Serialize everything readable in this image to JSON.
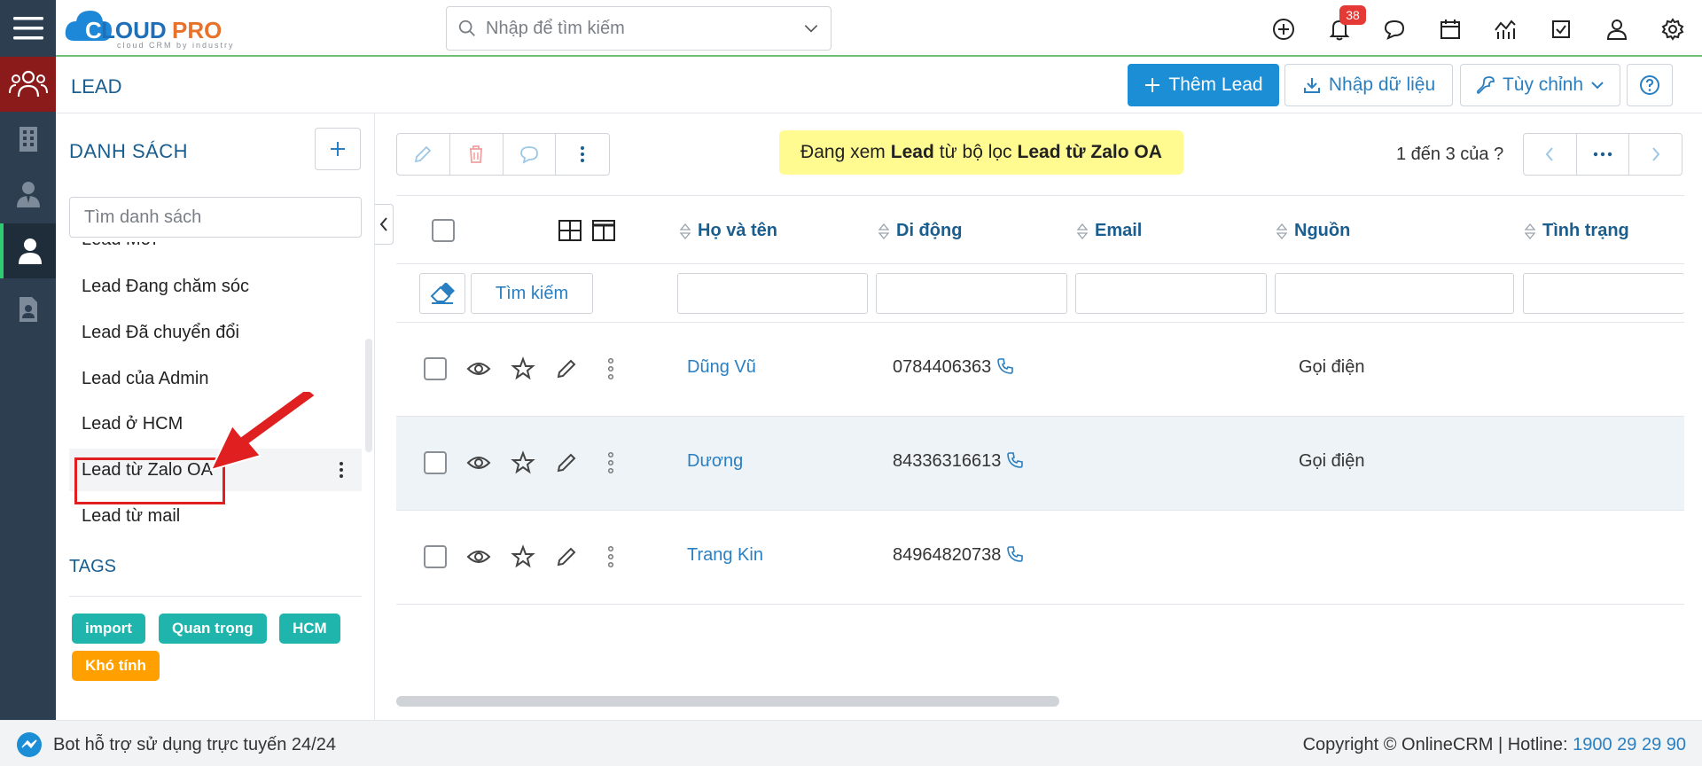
{
  "brand": {
    "name": "CLOUDPRO",
    "tagline": "cloud CRM by industry"
  },
  "topbar": {
    "search_placeholder": "Nhập để tìm kiếm",
    "notification_count": "38"
  },
  "header": {
    "title": "LEAD",
    "add_label": "Thêm Lead",
    "import_label": "Nhập dữ liệu",
    "customize_label": "Tùy chỉnh"
  },
  "lists": {
    "title": "DANH SÁCH",
    "search_placeholder": "Tìm danh sách",
    "items": [
      {
        "label": "Lead Mới"
      },
      {
        "label": "Lead Đang chăm sóc"
      },
      {
        "label": "Lead Đã chuyển đổi"
      },
      {
        "label": "Lead của Admin"
      },
      {
        "label": "Lead ở HCM"
      },
      {
        "label": "Lead từ Zalo OA"
      },
      {
        "label": "Lead từ mail"
      }
    ],
    "active_index": 5
  },
  "tags": {
    "title": "TAGS",
    "items": [
      {
        "label": "import",
        "color": "#1fb5ac"
      },
      {
        "label": "Quan trọng",
        "color": "#1fb5ac"
      },
      {
        "label": "HCM",
        "color": "#1fb5ac"
      },
      {
        "label": "Khó tính",
        "color": "#ffa000"
      }
    ]
  },
  "filter_note": {
    "prefix": "Đang xem",
    "module": "Lead",
    "middle": "từ bộ lọc",
    "filter": "Lead từ Zalo OA"
  },
  "pager": {
    "text": "1 đến 3 của",
    "unknown": "?"
  },
  "table": {
    "columns": [
      "Họ và tên",
      "Di động",
      "Email",
      "Nguồn",
      "Tình trạng"
    ],
    "search_button": "Tìm kiếm",
    "rows": [
      {
        "name": "Dũng Vũ",
        "mobile": "0784406363",
        "email": "",
        "source": "Gọi điện",
        "status": ""
      },
      {
        "name": "Dương",
        "mobile": "84336316613",
        "email": "",
        "source": "Gọi điện",
        "status": ""
      },
      {
        "name": "Trang Kin",
        "mobile": "84964820738",
        "email": "",
        "source": "",
        "status": ""
      }
    ]
  },
  "footer": {
    "bot_text": "Bot hỗ trợ sử dụng trực tuyến 24/24",
    "copyright": "Copyright © OnlineCRM",
    "hotline_label": "Hotline:",
    "hotline": "1900 29 29 90"
  },
  "colors": {
    "accent": "#1b8ed6",
    "nav_bg": "#2c3e50",
    "highlight": "#fffb91",
    "active_nav": "#8b1a1a"
  }
}
